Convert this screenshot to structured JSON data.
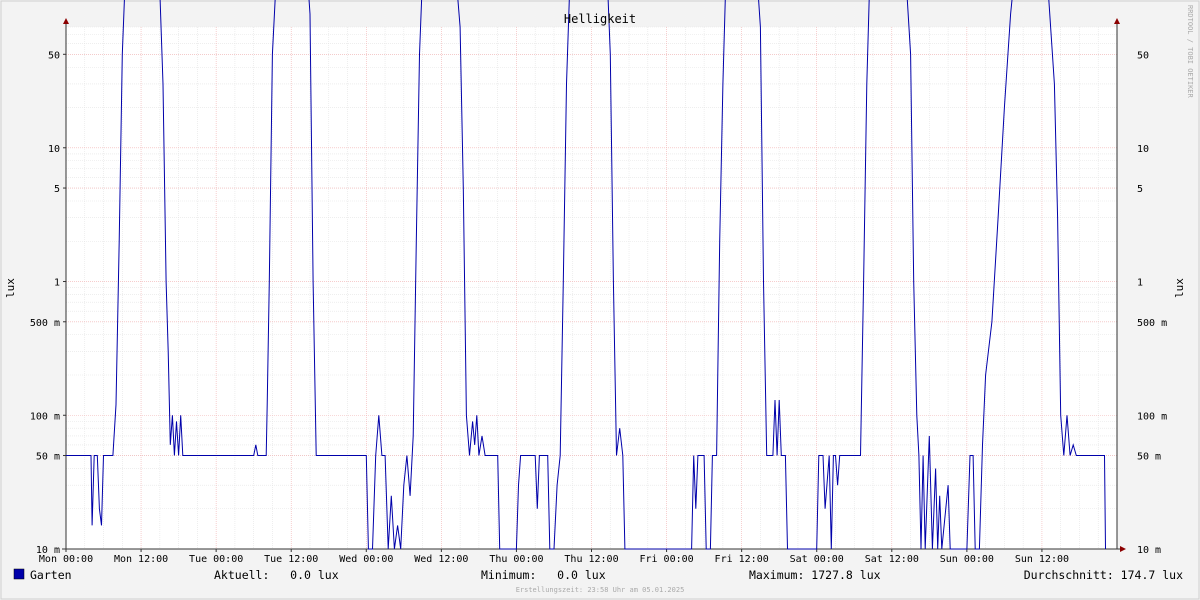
{
  "chart_data": {
    "type": "line",
    "title": "Helligkeit",
    "ylabel": "lux",
    "yscale": "log",
    "ylim": [
      10,
      80000
    ],
    "grid": true,
    "x_ticks": [
      "Mon 00:00",
      "Mon 12:00",
      "Tue 00:00",
      "Tue 12:00",
      "Wed 00:00",
      "Wed 12:00",
      "Thu 00:00",
      "Thu 12:00",
      "Fri 00:00",
      "Fri 12:00",
      "Sat 00:00",
      "Sat 12:00",
      "Sun 00:00",
      "Sun 12:00"
    ],
    "y_ticks": [
      {
        "v": 10,
        "label": "10 m"
      },
      {
        "v": 50,
        "label": "50 m"
      },
      {
        "v": 100,
        "label": "100 m"
      },
      {
        "v": 500,
        "label": "500 m"
      },
      {
        "v": 1000,
        "label": "1"
      },
      {
        "v": 5000,
        "label": "5"
      },
      {
        "v": 10000,
        "label": "10"
      },
      {
        "v": 50000,
        "label": "50"
      },
      {
        "v": 100000,
        "label": "100"
      },
      {
        "v": 500000,
        "label": "500"
      },
      {
        "v": 1000000,
        "label": "1 k"
      },
      {
        "v": 5000000,
        "label": "5 k"
      },
      {
        "v": 10000000,
        "label": "10 k"
      },
      {
        "v": 50000000,
        "label": "50 k"
      }
    ],
    "series": [
      {
        "name": "Garten",
        "color": "#0000aa",
        "points": [
          [
            "Mon 00:00",
            50
          ],
          [
            "Mon 04:00",
            50
          ],
          [
            "Mon 04:10",
            15
          ],
          [
            "Mon 04:30",
            50
          ],
          [
            "Mon 05:00",
            50
          ],
          [
            "Mon 05:20",
            20
          ],
          [
            "Mon 05:40",
            15
          ],
          [
            "Mon 06:00",
            50
          ],
          [
            "Mon 07:30",
            50
          ],
          [
            "Mon 08:00",
            120
          ],
          [
            "Mon 08:30",
            2000
          ],
          [
            "Mon 09:00",
            50000
          ],
          [
            "Mon 09:30",
            200000
          ],
          [
            "Mon 10:00",
            500000
          ],
          [
            "Mon 11:00",
            900000
          ],
          [
            "Mon 12:00",
            1100000
          ],
          [
            "Mon 13:00",
            900000
          ],
          [
            "Mon 14:00",
            400000
          ],
          [
            "Mon 15:00",
            150000
          ],
          [
            "Mon 15:30",
            30000
          ],
          [
            "Mon 16:00",
            1000
          ],
          [
            "Mon 16:20",
            300
          ],
          [
            "Mon 16:40",
            60
          ],
          [
            "Mon 17:00",
            100
          ],
          [
            "Mon 17:20",
            50
          ],
          [
            "Mon 17:40",
            90
          ],
          [
            "Mon 18:00",
            50
          ],
          [
            "Mon 18:20",
            100
          ],
          [
            "Mon 18:40",
            50
          ],
          [
            "Tue 06:00",
            50
          ],
          [
            "Tue 06:20",
            60
          ],
          [
            "Tue 06:40",
            50
          ],
          [
            "Tue 08:00",
            50
          ],
          [
            "Tue 08:10",
            120
          ],
          [
            "Tue 08:30",
            1000
          ],
          [
            "Tue 09:00",
            50000
          ],
          [
            "Tue 09:30",
            150000
          ],
          [
            "Tue 10:00",
            300000
          ],
          [
            "Tue 11:00",
            650000
          ],
          [
            "Tue 12:00",
            800000
          ],
          [
            "Tue 13:00",
            700000
          ],
          [
            "Tue 14:00",
            500000
          ],
          [
            "Tue 15:00",
            100000
          ],
          [
            "Tue 15:30",
            1000
          ],
          [
            "Tue 16:00",
            50
          ],
          [
            "Wed 00:00",
            50
          ],
          [
            "Wed 00:20",
            10
          ],
          [
            "Wed 01:00",
            10
          ],
          [
            "Wed 01:30",
            50
          ],
          [
            "Wed 02:00",
            100
          ],
          [
            "Wed 02:30",
            50
          ],
          [
            "Wed 03:00",
            50
          ],
          [
            "Wed 03:30",
            10
          ],
          [
            "Wed 04:00",
            25
          ],
          [
            "Wed 04:30",
            10
          ],
          [
            "Wed 05:00",
            15
          ],
          [
            "Wed 05:30",
            10
          ],
          [
            "Wed 06:00",
            30
          ],
          [
            "Wed 06:30",
            50
          ],
          [
            "Wed 07:00",
            25
          ],
          [
            "Wed 07:30",
            70
          ],
          [
            "Wed 08:00",
            2000
          ],
          [
            "Wed 08:30",
            50000
          ],
          [
            "Wed 09:00",
            200000
          ],
          [
            "Wed 10:00",
            500000
          ],
          [
            "Wed 11:00",
            900000
          ],
          [
            "Wed 11:30",
            1200000
          ],
          [
            "Wed 12:00",
            700000
          ],
          [
            "Wed 13:00",
            500000
          ],
          [
            "Wed 14:00",
            300000
          ],
          [
            "Wed 15:00",
            80000
          ],
          [
            "Wed 15:30",
            5000
          ],
          [
            "Wed 16:00",
            100
          ],
          [
            "Wed 16:30",
            50
          ],
          [
            "Wed 17:00",
            90
          ],
          [
            "Wed 17:20",
            60
          ],
          [
            "Wed 17:40",
            100
          ],
          [
            "Wed 18:00",
            50
          ],
          [
            "Wed 18:30",
            70
          ],
          [
            "Wed 19:00",
            50
          ],
          [
            "Wed 21:00",
            50
          ],
          [
            "Wed 21:20",
            10
          ],
          [
            "Thu 00:00",
            10
          ],
          [
            "Thu 00:20",
            30
          ],
          [
            "Thu 00:40",
            50
          ],
          [
            "Thu 03:00",
            50
          ],
          [
            "Thu 03:20",
            20
          ],
          [
            "Thu 03:40",
            50
          ],
          [
            "Thu 05:00",
            50
          ],
          [
            "Thu 05:20",
            10
          ],
          [
            "Thu 06:00",
            10
          ],
          [
            "Thu 06:30",
            30
          ],
          [
            "Thu 07:00",
            50
          ],
          [
            "Thu 07:30",
            1000
          ],
          [
            "Thu 08:00",
            30000
          ],
          [
            "Thu 08:30",
            150000
          ],
          [
            "Thu 09:30",
            500000
          ],
          [
            "Thu 10:30",
            1000000
          ],
          [
            "Thu 11:00",
            1600000
          ],
          [
            "Thu 11:30",
            900000
          ],
          [
            "Thu 12:00",
            1700000
          ],
          [
            "Thu 12:30",
            1000000
          ],
          [
            "Thu 13:30",
            600000
          ],
          [
            "Thu 14:30",
            200000
          ],
          [
            "Thu 15:00",
            50000
          ],
          [
            "Thu 15:30",
            1000
          ],
          [
            "Thu 16:00",
            50
          ],
          [
            "Thu 16:30",
            80
          ],
          [
            "Thu 17:00",
            50
          ],
          [
            "Thu 17:20",
            10
          ],
          [
            "Fri 04:00",
            10
          ],
          [
            "Fri 04:20",
            50
          ],
          [
            "Fri 04:40",
            20
          ],
          [
            "Fri 05:00",
            50
          ],
          [
            "Fri 06:00",
            50
          ],
          [
            "Fri 06:20",
            10
          ],
          [
            "Fri 07:00",
            10
          ],
          [
            "Fri 07:20",
            50
          ],
          [
            "Fri 08:00",
            50
          ],
          [
            "Fri 08:30",
            2000
          ],
          [
            "Fri 09:00",
            30000
          ],
          [
            "Fri 09:30",
            200000
          ],
          [
            "Fri 10:30",
            600000
          ],
          [
            "Fri 11:00",
            1300000
          ],
          [
            "Fri 12:00",
            1000000
          ],
          [
            "Fri 13:00",
            800000
          ],
          [
            "Fri 14:00",
            400000
          ],
          [
            "Fri 15:00",
            80000
          ],
          [
            "Fri 15:30",
            1000
          ],
          [
            "Fri 16:00",
            50
          ],
          [
            "Fri 17:00",
            50
          ],
          [
            "Fri 17:20",
            130
          ],
          [
            "Fri 17:40",
            50
          ],
          [
            "Fri 18:00",
            130
          ],
          [
            "Fri 18:20",
            50
          ],
          [
            "Fri 19:00",
            50
          ],
          [
            "Fri 19:20",
            10
          ],
          [
            "Sat 00:00",
            10
          ],
          [
            "Sat 00:20",
            50
          ],
          [
            "Sat 01:00",
            50
          ],
          [
            "Sat 01:20",
            20
          ],
          [
            "Sat 02:00",
            50
          ],
          [
            "Sat 02:20",
            10
          ],
          [
            "Sat 02:40",
            50
          ],
          [
            "Sat 03:00",
            50
          ],
          [
            "Sat 03:20",
            30
          ],
          [
            "Sat 03:40",
            50
          ],
          [
            "Sat 07:00",
            50
          ],
          [
            "Sat 07:30",
            1000
          ],
          [
            "Sat 08:00",
            30000
          ],
          [
            "Sat 08:30",
            200000
          ],
          [
            "Sat 09:30",
            400000
          ],
          [
            "Sat 10:30",
            700000
          ],
          [
            "Sat 11:30",
            1100000
          ],
          [
            "Sat 12:00",
            800000
          ],
          [
            "Sat 13:00",
            600000
          ],
          [
            "Sat 14:00",
            300000
          ],
          [
            "Sat 15:00",
            50000
          ],
          [
            "Sat 15:30",
            1000
          ],
          [
            "Sat 16:00",
            100
          ],
          [
            "Sat 16:20",
            50
          ],
          [
            "Sat 16:40",
            10
          ],
          [
            "Sat 17:00",
            50
          ],
          [
            "Sat 17:20",
            10
          ],
          [
            "Sat 18:00",
            70
          ],
          [
            "Sat 18:30",
            10
          ],
          [
            "Sat 19:00",
            40
          ],
          [
            "Sat 19:20",
            10
          ],
          [
            "Sat 19:40",
            25
          ],
          [
            "Sat 20:00",
            10
          ],
          [
            "Sat 21:00",
            30
          ],
          [
            "Sat 21:20",
            10
          ],
          [
            "Sun 00:00",
            10
          ],
          [
            "Sun 00:30",
            50
          ],
          [
            "Sun 01:00",
            50
          ],
          [
            "Sun 01:20",
            10
          ],
          [
            "Sun 02:00",
            10
          ],
          [
            "Sun 02:30",
            60
          ],
          [
            "Sun 03:00",
            200
          ],
          [
            "Sun 04:00",
            500
          ],
          [
            "Sun 05:00",
            3000
          ],
          [
            "Sun 06:00",
            20000
          ],
          [
            "Sun 07:00",
            100000
          ],
          [
            "Sun 08:00",
            300000
          ],
          [
            "Sun 09:00",
            600000
          ],
          [
            "Sun 10:00",
            700000
          ],
          [
            "Sun 11:00",
            500000
          ],
          [
            "Sun 12:00",
            300000
          ],
          [
            "Sun 13:00",
            150000
          ],
          [
            "Sun 14:00",
            30000
          ],
          [
            "Sun 14:30",
            3000
          ],
          [
            "Sun 15:00",
            100
          ],
          [
            "Sun 15:30",
            50
          ],
          [
            "Sun 16:00",
            100
          ],
          [
            "Sun 16:30",
            50
          ],
          [
            "Sun 17:00",
            60
          ],
          [
            "Sun 17:30",
            50
          ],
          [
            "Sun 22:00",
            50
          ],
          [
            "Sun 22:10",
            10
          ]
        ]
      }
    ]
  },
  "legend": {
    "series_name": "Garten",
    "series_color": "#0000aa",
    "aktuell": "Aktuell:   0.0 lux",
    "minimum": "Minimum:   0.0 lux",
    "maximum": "Maximum: 1727.8 lux",
    "durchschnitt": "Durchschnitt: 174.7 lux"
  },
  "watermark": "RRDTOOL / TOBI OETIKER",
  "footer": "Erstellungszeit: 23:58 Uhr am 05.01.2025"
}
